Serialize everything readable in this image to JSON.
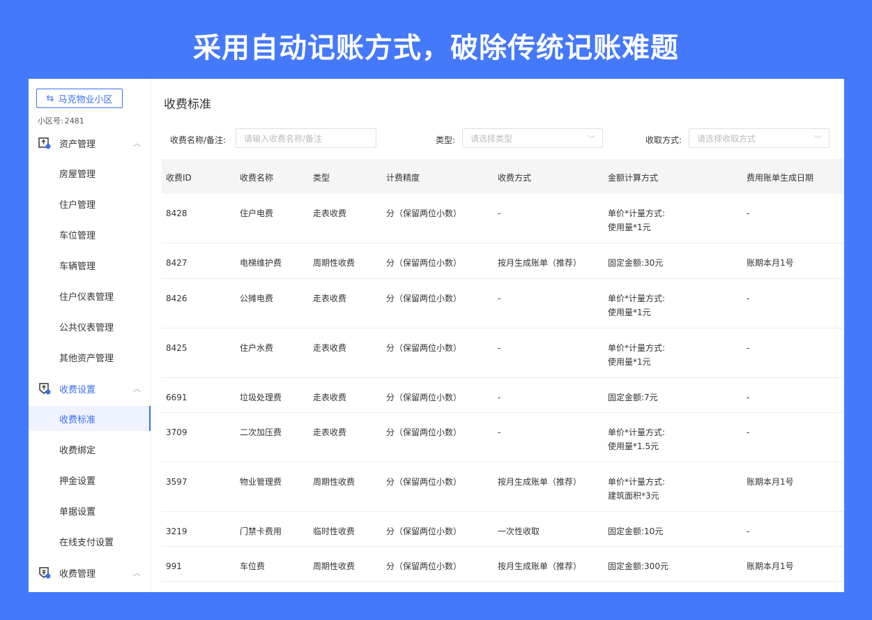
{
  "banner": {
    "title": "采用自动记账方式，破除传统记账难题"
  },
  "sidebar": {
    "community_button": "马克物业小区",
    "community_no_label": "小区号:",
    "community_no_value": "2481",
    "groups": [
      {
        "label": "资产管理",
        "icon": "asset-icon",
        "expanded": true,
        "items": [
          "房屋管理",
          "住户管理",
          "车位管理",
          "车辆管理",
          "住户仪表管理",
          "公共仪表管理",
          "其他资产管理"
        ]
      },
      {
        "label": "收费设置",
        "icon": "fee-settings-icon",
        "expanded": true,
        "items": [
          "收费标准",
          "收费绑定",
          "押金设置",
          "单据设置",
          "在线支付设置"
        ]
      },
      {
        "label": "收费管理",
        "icon": "fee-management-icon",
        "expanded": true,
        "items": []
      }
    ],
    "active_item": "收费标准"
  },
  "main": {
    "title": "收费标准",
    "filters": {
      "name_label": "收费名称/备注:",
      "name_placeholder": "请输入收费名称/备注",
      "type_label": "类型:",
      "type_placeholder": "请选择类型",
      "method_label": "收取方式:",
      "method_placeholder": "请选择收取方式"
    },
    "table": {
      "columns": [
        "收费ID",
        "收费名称",
        "类型",
        "计费精度",
        "收费方式",
        "金额计算方式",
        "费用账单生成日期"
      ],
      "rows": [
        [
          "8428",
          "住户电费",
          "走表收费",
          "分（保留两位小数）",
          "-",
          "单价*计量方式:",
          "使用量*1元",
          "-"
        ],
        [
          "8427",
          "电梯维护费",
          "周期性收费",
          "分（保留两位小数）",
          "按月生成账单（推荐）",
          "固定金额:30元",
          "",
          "账期本月1号"
        ],
        [
          "8426",
          "公摊电费",
          "走表收费",
          "分（保留两位小数）",
          "-",
          "单价*计量方式:",
          "使用量*1元",
          "-"
        ],
        [
          "8425",
          "住户水费",
          "走表收费",
          "分（保留两位小数）",
          "-",
          "单价*计量方式:",
          "使用量*1元",
          "-"
        ],
        [
          "6691",
          "垃圾处理费",
          "走表收费",
          "分（保留两位小数）",
          "-",
          "固定金额:7元",
          "",
          "-"
        ],
        [
          "3709",
          "二次加压费",
          "走表收费",
          "分（保留两位小数）",
          "-",
          "单价*计量方式:",
          "使用量*1.5元",
          "-"
        ],
        [
          "3597",
          "物业管理费",
          "周期性收费",
          "分（保留两位小数）",
          "按月生成账单（推荐）",
          "单价*计量方式:",
          "建筑面积*3元",
          "账期本月1号"
        ],
        [
          "3219",
          "门禁卡费用",
          "临时性收费",
          "分（保留两位小数）",
          "一次性收取",
          "固定金额:10元",
          "",
          "-"
        ],
        [
          "991",
          "车位费",
          "周期性收费",
          "分（保留两位小数）",
          "按月生成账单（推荐）",
          "固定金额:300元",
          "",
          "账期本月1号"
        ]
      ]
    }
  },
  "colors": {
    "brand": "#4479fb",
    "accent": "#3a6ff0"
  }
}
